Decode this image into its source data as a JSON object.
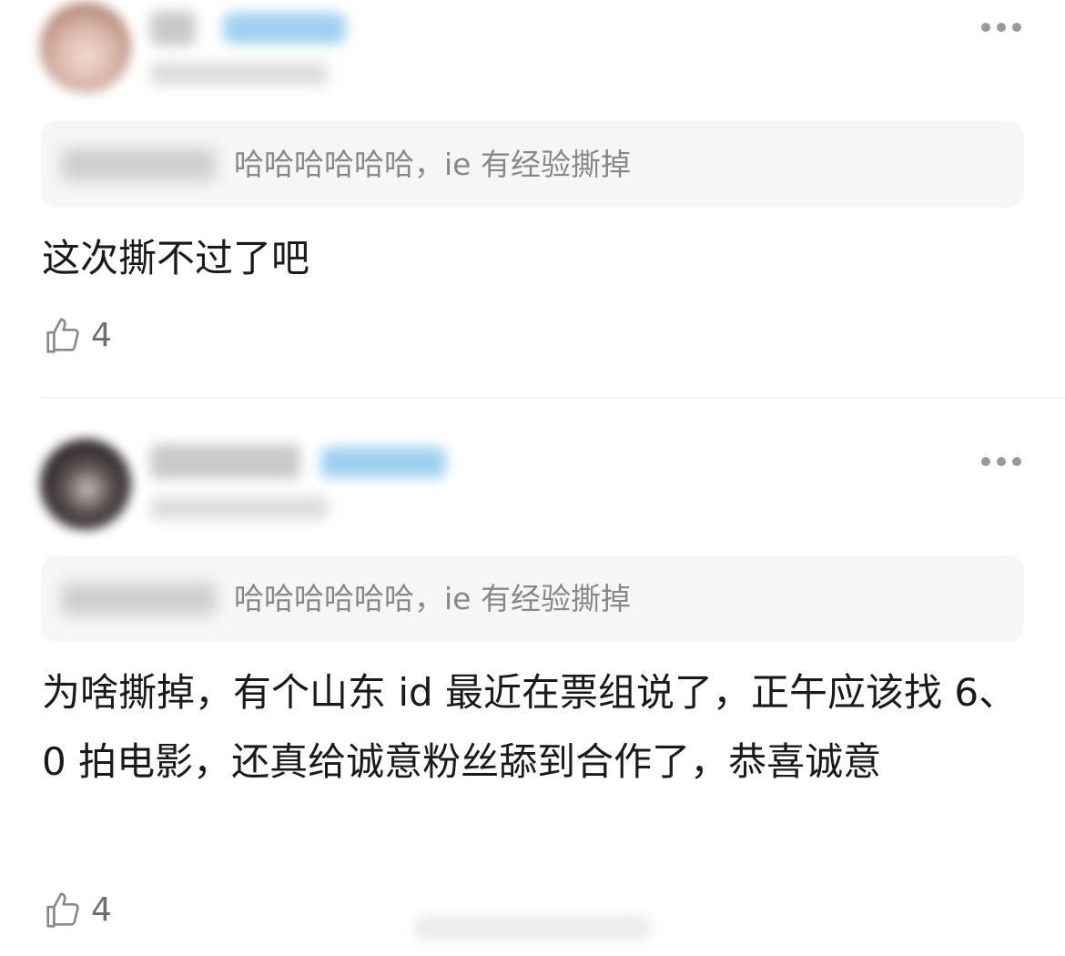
{
  "comments": [
    {
      "quote": {
        "text": "哈哈哈哈哈哈，ie 有经验撕掉"
      },
      "body": "这次撕不过了吧",
      "likes": "4",
      "more_icon": "ellipsis-icon",
      "like_icon": "thumbs-up-icon"
    },
    {
      "quote": {
        "text": "哈哈哈哈哈哈，ie 有经验撕掉"
      },
      "body": "为啥撕掉，有个山东 id 最近在票组说了，正午应该找 6、0 拍电影，还真给诚意粉丝舔到合作了，恭喜诚意",
      "likes": "4",
      "more_icon": "ellipsis-icon",
      "like_icon": "thumbs-up-icon"
    }
  ],
  "colors": {
    "quote_bg": "#f6f6f6",
    "quote_text": "#888888",
    "body_text": "#1a1a1a",
    "icon_gray": "#9a9a9a",
    "badge_blue": "#9fd0f0"
  }
}
